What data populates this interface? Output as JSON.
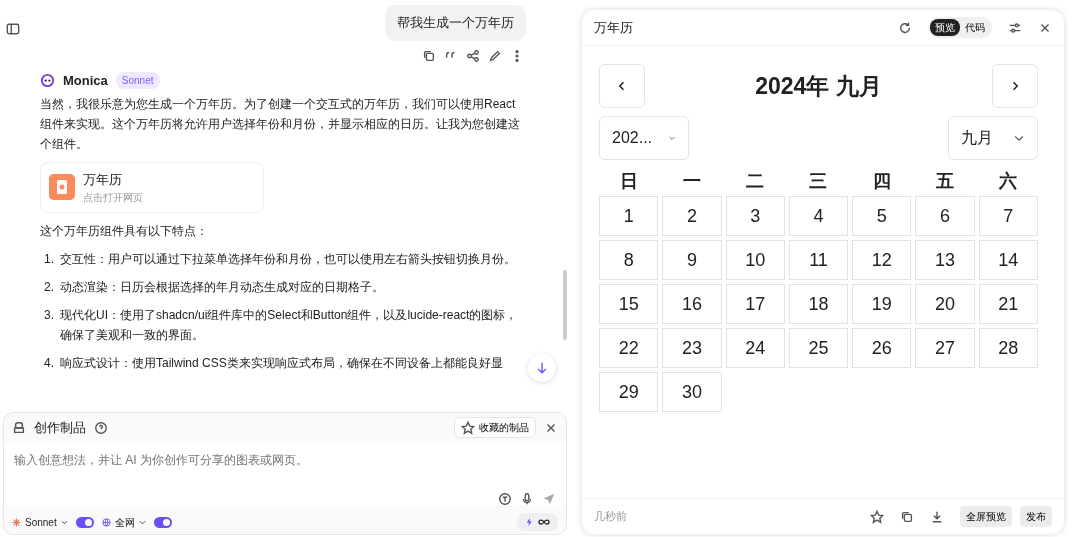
{
  "chat": {
    "user_message": "帮我生成一个万年历",
    "assistant": {
      "name": "Monica",
      "model_badge": "Sonnet",
      "intro": "当然，我很乐意为您生成一个万年历。为了创建一个交互式的万年历，我们可以使用React组件来实现。这个万年历将允许用户选择年份和月份，并显示相应的日历。让我为您创建这个组件。",
      "artifact": {
        "title": "万年历",
        "subtitle": "点击打开网页"
      },
      "features_heading": "这个万年历组件具有以下特点：",
      "features": [
        {
          "number": "1.",
          "text": "交互性：用户可以通过下拉菜单选择年份和月份，也可以使用左右箭头按钮切换月份。"
        },
        {
          "number": "2.",
          "text": "动态渲染：日历会根据选择的年月动态生成对应的日期格子。"
        },
        {
          "number": "3.",
          "text": "现代化UI：使用了shadcn/ui组件库中的Select和Button组件，以及lucide-react的图标，确保了美观和一致的界面。"
        },
        {
          "number": "4.",
          "text": "响应式设计：使用Tailwind CSS类来实现响应式布局，确保在不同设备上都能良好显"
        }
      ]
    }
  },
  "composer": {
    "title": "创作制品",
    "saved_button": "收藏的制品",
    "placeholder": "输入创意想法，并让 AI 为你创作可分享的图表或网页。",
    "model": {
      "label": "Sonnet",
      "on": true
    },
    "web": {
      "label": "全网",
      "on": true
    }
  },
  "preview": {
    "title": "万年历",
    "tabs": [
      {
        "label": "预览",
        "selected": true
      },
      {
        "label": "代码",
        "selected": false
      }
    ],
    "calendar": {
      "heading": "2024年 九月",
      "year_select": "202...",
      "month_select": "九月",
      "weekdays": [
        "日",
        "一",
        "二",
        "三",
        "四",
        "五",
        "六"
      ],
      "days": [
        "1",
        "2",
        "3",
        "4",
        "5",
        "6",
        "7",
        "8",
        "9",
        "10",
        "11",
        "12",
        "13",
        "14",
        "15",
        "16",
        "17",
        "18",
        "19",
        "20",
        "21",
        "22",
        "23",
        "24",
        "25",
        "26",
        "27",
        "28",
        "29",
        "30"
      ]
    },
    "footer": {
      "time": "几秒前",
      "fullscreen_button": "全屏预览",
      "publish_button": "发布"
    }
  }
}
